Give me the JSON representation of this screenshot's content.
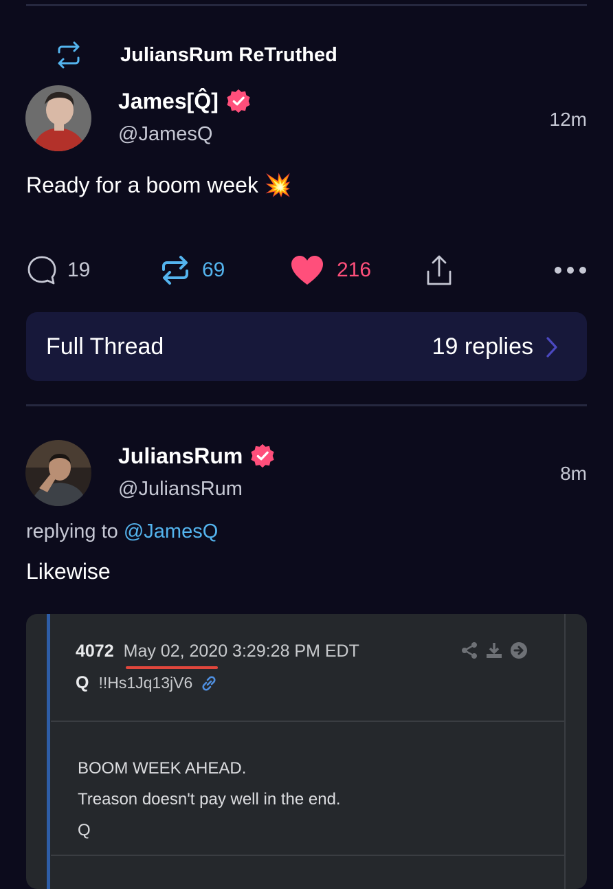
{
  "post1": {
    "retruth_label": "JuliansRum ReTruthed",
    "author_name": "James[Q̂]",
    "author_handle": "@JamesQ",
    "time": "12m",
    "text": "Ready for a boom week 💥",
    "actions": {
      "replies": "19",
      "retruths": "69",
      "likes": "216"
    },
    "thread": {
      "label": "Full Thread",
      "replies_label": "19 replies"
    }
  },
  "post2": {
    "author_name": "JuliansRum",
    "author_handle": "@JuliansRum",
    "time": "8m",
    "replying_prefix": "replying to ",
    "replying_handle": "@JamesQ",
    "text": "Likewise",
    "quote": {
      "post_number": "4072",
      "date": "May 02, 2020 3:29:28 PM EDT",
      "poster": "Q",
      "tripcode": "!!Hs1Jq13jV6",
      "lines": [
        "BOOM WEEK AHEAD.",
        "Treason doesn't pay well in the end.",
        "Q"
      ]
    }
  },
  "colors": {
    "background": "#0c0b1c",
    "accent_pink": "#ff4f7b",
    "accent_blue": "#54b4ee",
    "thread_bg": "#17183a"
  },
  "icons": {
    "retruth": "retruth-icon",
    "verified": "verified-badge-icon",
    "reply": "reply-icon",
    "like": "heart-icon",
    "share": "share-icon",
    "more": "more-icon",
    "chevron": "chevron-right-icon"
  }
}
